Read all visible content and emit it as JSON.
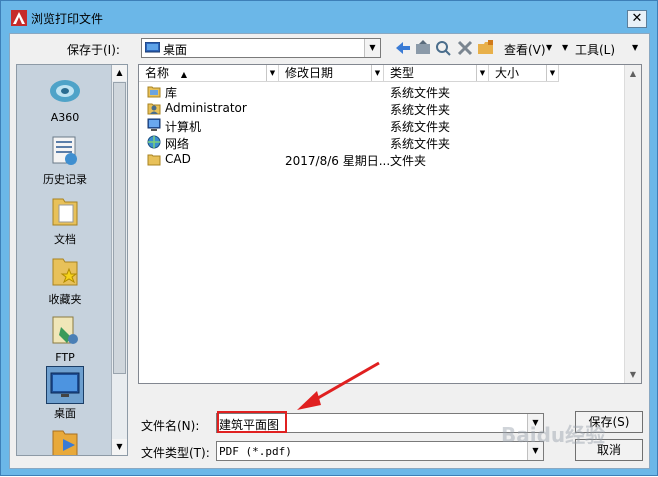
{
  "window": {
    "title": "浏览打印文件",
    "close_glyph": "✕"
  },
  "toolbar": {
    "save_in_label": "保存于(I):",
    "location_value": "桌面",
    "view_label": "查看(V)",
    "tools_label": "工具(L)"
  },
  "places": [
    {
      "label": "A360",
      "icon": "a360-icon"
    },
    {
      "label": "历史记录",
      "icon": "history-icon"
    },
    {
      "label": "文档",
      "icon": "documents-icon"
    },
    {
      "label": "收藏夹",
      "icon": "favorites-icon"
    },
    {
      "label": "FTP",
      "icon": "ftp-icon"
    },
    {
      "label": "桌面",
      "icon": "desktop-icon"
    }
  ],
  "columns": [
    "名称",
    "修改日期",
    "类型",
    "大小"
  ],
  "files": [
    {
      "name": "库",
      "date": "",
      "type": "系统文件夹",
      "icon": "library-icon"
    },
    {
      "name": "Administrator",
      "date": "",
      "type": "系统文件夹",
      "icon": "user-icon"
    },
    {
      "name": "计算机",
      "date": "",
      "type": "系统文件夹",
      "icon": "computer-icon"
    },
    {
      "name": "网络",
      "date": "",
      "type": "系统文件夹",
      "icon": "network-icon"
    },
    {
      "name": "CAD",
      "date": "2017/8/6 星期日...",
      "type": "文件夹",
      "icon": "folder-icon"
    }
  ],
  "form": {
    "filename_label": "文件名(N):",
    "filename_value": "建筑平面图",
    "filetype_label": "文件类型(T):",
    "filetype_value": "PDF (*.pdf)",
    "save_label": "保存(S)",
    "cancel_label": "取消"
  },
  "watermark": "Baidu经验",
  "colors": {
    "title_bar": "#6bb7e8",
    "annotation": "#e02020",
    "folder": "#e8c15a"
  }
}
